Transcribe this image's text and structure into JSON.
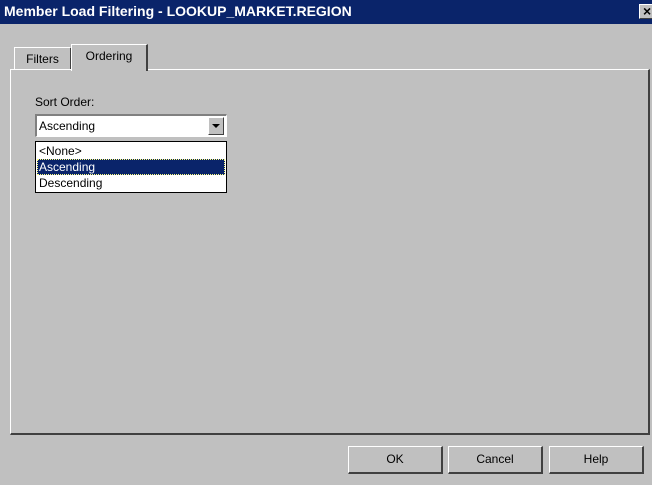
{
  "window": {
    "title": "Member Load Filtering - LOOKUP_MARKET.REGION",
    "close_glyph": "✕"
  },
  "tabs": [
    {
      "label": "Filters",
      "active": false
    },
    {
      "label": "Ordering",
      "active": true
    }
  ],
  "ordering": {
    "sort_order_label": "Sort Order:",
    "selected_value": "Ascending",
    "options": [
      "<None>",
      "Ascending",
      "Descending"
    ],
    "highlighted_index": 1
  },
  "buttons": {
    "ok": "OK",
    "cancel": "Cancel",
    "help": "Help"
  },
  "colors": {
    "titlebar": "#0a246a",
    "face": "#c0c0c0",
    "highlight": "#0a246a"
  }
}
